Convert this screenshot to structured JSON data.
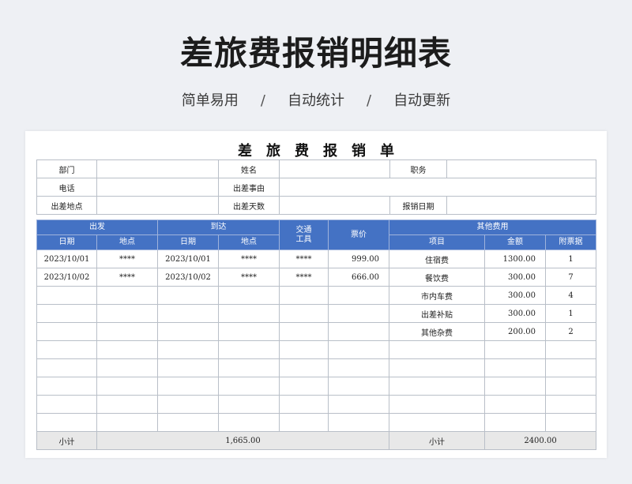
{
  "header": {
    "title": "差旅费报销明细表",
    "taglines": [
      "简单易用",
      "自动统计",
      "自动更新"
    ],
    "separator": "/"
  },
  "form": {
    "title_chars": [
      "差",
      "旅",
      "费",
      "报",
      "销",
      "单"
    ],
    "labels": {
      "department": "部门",
      "name": "姓名",
      "position": "职务",
      "phone": "电话",
      "reason": "出差事由",
      "location": "出差地点",
      "days": "出差天数",
      "claim_date": "报销日期"
    },
    "values": {
      "department": "",
      "name": "",
      "position": "",
      "phone": "",
      "reason": "",
      "location": "",
      "days": "",
      "claim_date": ""
    }
  },
  "table": {
    "group_headers": {
      "depart": "出发",
      "arrive": "到达",
      "transport": "交通\n工具",
      "fare": "票价",
      "other": "其他费用"
    },
    "sub_headers": {
      "depart_date": "日期",
      "depart_place": "地点",
      "arrive_date": "日期",
      "arrive_place": "地点",
      "item": "项目",
      "amount": "金额",
      "attachments": "附票据"
    },
    "rows": [
      {
        "depart_date": "2023/10/01",
        "depart_place": "****",
        "arrive_date": "2023/10/01",
        "arrive_place": "****",
        "transport": "****",
        "fare": "999.00",
        "item": "住宿费",
        "amount": "1300.00",
        "attachments": "1"
      },
      {
        "depart_date": "2023/10/02",
        "depart_place": "****",
        "arrive_date": "2023/10/02",
        "arrive_place": "****",
        "transport": "****",
        "fare": "666.00",
        "item": "餐饮费",
        "amount": "300.00",
        "attachments": "7"
      },
      {
        "depart_date": "",
        "depart_place": "",
        "arrive_date": "",
        "arrive_place": "",
        "transport": "",
        "fare": "",
        "item": "市内车费",
        "amount": "300.00",
        "attachments": "4"
      },
      {
        "depart_date": "",
        "depart_place": "",
        "arrive_date": "",
        "arrive_place": "",
        "transport": "",
        "fare": "",
        "item": "出差补贴",
        "amount": "300.00",
        "attachments": "1"
      },
      {
        "depart_date": "",
        "depart_place": "",
        "arrive_date": "",
        "arrive_place": "",
        "transport": "",
        "fare": "",
        "item": "其他杂费",
        "amount": "200.00",
        "attachments": "2"
      },
      {
        "depart_date": "",
        "depart_place": "",
        "arrive_date": "",
        "arrive_place": "",
        "transport": "",
        "fare": "",
        "item": "",
        "amount": "",
        "attachments": ""
      },
      {
        "depart_date": "",
        "depart_place": "",
        "arrive_date": "",
        "arrive_place": "",
        "transport": "",
        "fare": "",
        "item": "",
        "amount": "",
        "attachments": ""
      },
      {
        "depart_date": "",
        "depart_place": "",
        "arrive_date": "",
        "arrive_place": "",
        "transport": "",
        "fare": "",
        "item": "",
        "amount": "",
        "attachments": ""
      },
      {
        "depart_date": "",
        "depart_place": "",
        "arrive_date": "",
        "arrive_place": "",
        "transport": "",
        "fare": "",
        "item": "",
        "amount": "",
        "attachments": ""
      },
      {
        "depart_date": "",
        "depart_place": "",
        "arrive_date": "",
        "arrive_place": "",
        "transport": "",
        "fare": "",
        "item": "",
        "amount": "",
        "attachments": ""
      }
    ],
    "totals": {
      "left_label": "小计",
      "left_value": "1,665.00",
      "right_label": "小计",
      "right_value": "2400.00"
    }
  },
  "colors": {
    "header_blue": "#4472c4",
    "background": "#eef0f4",
    "total_row": "#e8e8e8"
  }
}
